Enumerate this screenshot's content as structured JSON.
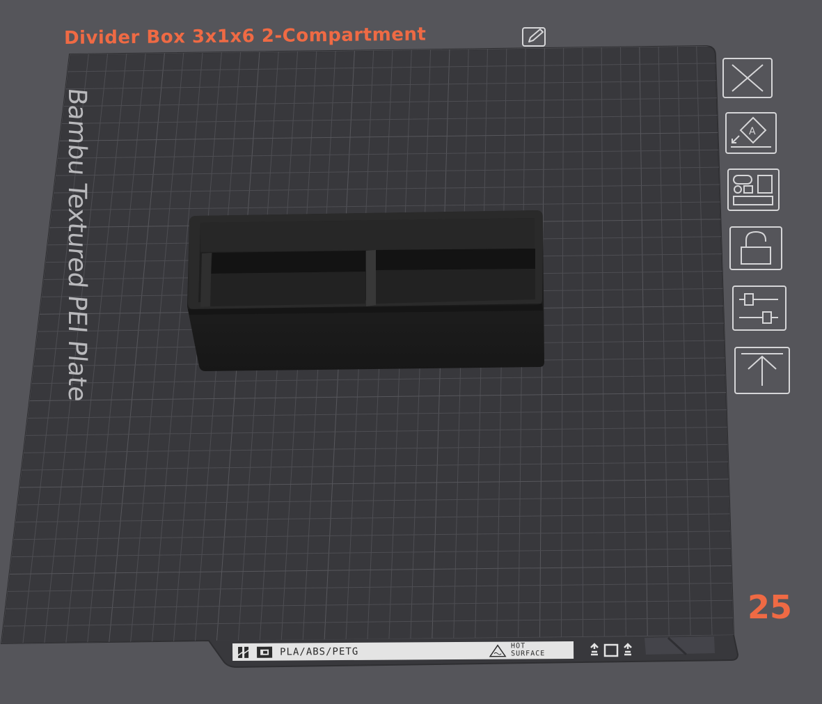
{
  "plate": {
    "title": "Divider Box 3x1x6 2-Compartment",
    "surface_label": "Bambu Textured PEI Plate",
    "number": "25",
    "strip": {
      "materials": "PLA/ABS/PETG",
      "hot_line1": "HOT",
      "hot_line2": "SURFACE"
    }
  },
  "colors": {
    "accent": "#ef6a44",
    "background": "#55555a",
    "plate": "#38383c",
    "grid": "#4d4d52",
    "model": "#1b1b1b",
    "icon_stroke": "#d6d6d8"
  },
  "toolbar": [
    {
      "icon": "close-icon"
    },
    {
      "icon": "auto-orient-icon"
    },
    {
      "icon": "arrange-icon"
    },
    {
      "icon": "lock-icon"
    },
    {
      "icon": "plate-settings-icon"
    },
    {
      "icon": "move-to-top-icon"
    }
  ]
}
